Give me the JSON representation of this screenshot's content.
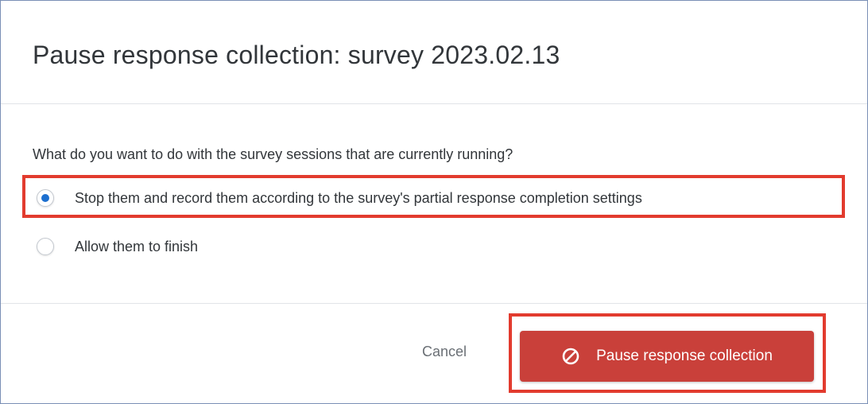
{
  "dialog": {
    "title": "Pause response collection: survey 2023.02.13"
  },
  "body": {
    "question": "What do you want to do with the survey sessions that are currently running?",
    "options": [
      {
        "label": "Stop them and record them according to the survey's partial response completion settings",
        "selected": true
      },
      {
        "label": "Allow them to finish",
        "selected": false
      }
    ]
  },
  "footer": {
    "cancel_label": "Cancel",
    "primary_label": "Pause response collection",
    "primary_icon": "prohibited-icon"
  },
  "colors": {
    "primary_button": "#c9403a",
    "radio_selected": "#1c6fcf",
    "annotation_highlight": "#e23b2e"
  }
}
